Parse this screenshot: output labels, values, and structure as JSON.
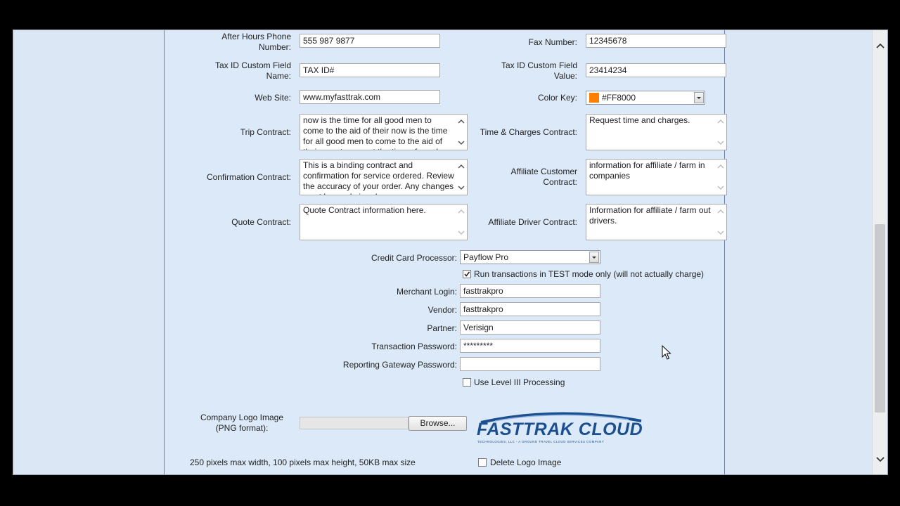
{
  "fields": {
    "after_hours_phone": {
      "label": "After Hours Phone Number:",
      "value": "555 987 9877"
    },
    "fax_number": {
      "label": "Fax Number:",
      "value": "12345678"
    },
    "tax_id_name": {
      "label": "Tax ID Custom Field Name:",
      "value": "TAX ID#"
    },
    "tax_id_value": {
      "label": "Tax ID Custom Field Value:",
      "value": "23414234"
    },
    "web_site": {
      "label": "Web Site:",
      "value": "www.myfasttrak.com"
    },
    "color_key": {
      "label": "Color Key:",
      "value": "#FF8000",
      "swatch": "#FF8000"
    }
  },
  "contracts": {
    "trip": {
      "label": "Trip Contract:",
      "value": "now is the time for all good men to come to the aid of their now is the time for all good men to come to the aid of their countrymen at the time of need"
    },
    "time_charges": {
      "label": "Time & Charges Contract:",
      "value": "Request time and charges."
    },
    "confirmation": {
      "label": "Confirmation Contract:",
      "value": "This is a binding contract and confirmation for service ordered. Review the accuracy of your order.  Any changes must be made in advance"
    },
    "affiliate_customer": {
      "label": "Affiliate Customer Contract:",
      "value": "information for affiliate / farm in companies"
    },
    "quote": {
      "label": "Quote Contract:",
      "value": "Quote Contract information here."
    },
    "affiliate_driver": {
      "label": "Affiliate Driver Contract:",
      "value": "Information for affiliate / farm out drivers."
    }
  },
  "payment": {
    "processor_label": "Credit Card Processor:",
    "processor_value": "Payflow Pro",
    "test_mode_label": "Run transactions in TEST mode only (will not actually charge)",
    "test_mode_checked": true,
    "merchant_login": {
      "label": "Merchant Login:",
      "value": "fasttrakpro"
    },
    "vendor": {
      "label": "Vendor:",
      "value": "fasttrakpro"
    },
    "partner": {
      "label": "Partner:",
      "value": "Verisign"
    },
    "transaction_password": {
      "label": "Transaction Password:",
      "value": "*********"
    },
    "reporting_password": {
      "label": "Reporting Gateway Password:",
      "value": ""
    },
    "level3_label": "Use Level III Processing",
    "level3_checked": false
  },
  "logo": {
    "label": "Company Logo Image (PNG format):",
    "browse_label": "Browse...",
    "file_value": "",
    "brand_text": "FASTTRAK CLOUD",
    "brand_tagline": "TECHNOLOGIES, LLC - A GROUND TRAVEL CLOUD SERVICES COMPANY",
    "hint": "250 pixels max width, 100 pixels max height, 50KB max size",
    "delete_label": "Delete Logo Image",
    "delete_checked": false
  },
  "colors": {
    "brand_blue": "#1c4f8f",
    "page_bg": "#dce9f8"
  },
  "icons": [
    "scroll-up-icon",
    "scroll-down-icon",
    "checkmark-icon",
    "dropdown-arrow-icon",
    "mouse-cursor-icon"
  ]
}
